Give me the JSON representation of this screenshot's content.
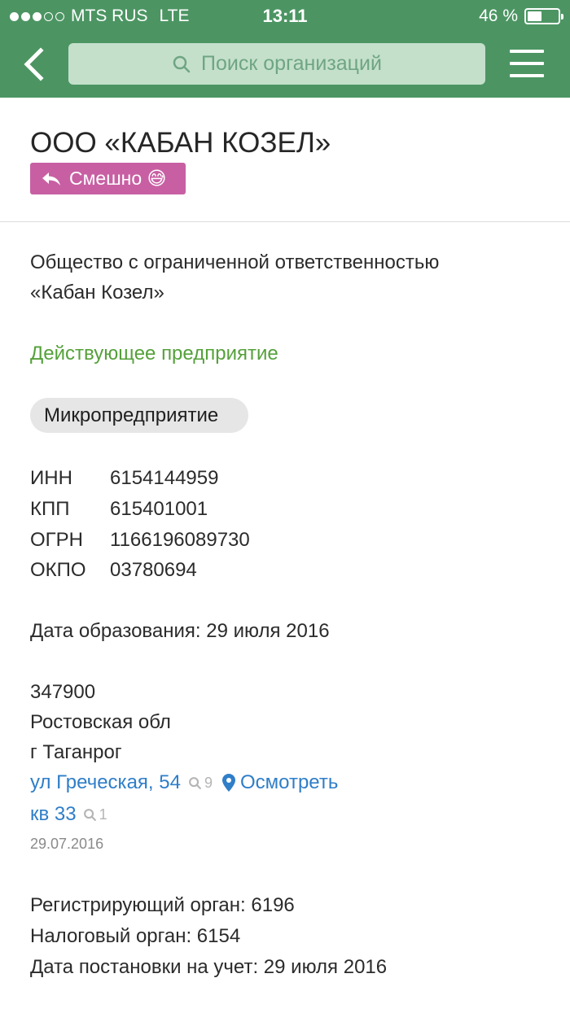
{
  "status_bar": {
    "carrier": "MTS RUS",
    "network": "LTE",
    "time": "13:11",
    "battery": "46 %",
    "signal_bars_filled": 3,
    "signal_bars_total": 5,
    "battery_level": 0.46
  },
  "nav": {
    "search_placeholder": "Поиск организаций"
  },
  "header": {
    "title": "ООО «КАБАН КОЗЕЛ»",
    "tag_label": "Смешно 😅"
  },
  "org": {
    "full_name_line1": "Общество с ограниченной ответственностью",
    "full_name_line2": "«Кабан Козел»",
    "status": "Действующее предприятие",
    "category": "Микропредприятие",
    "codes": [
      {
        "label": "ИНН",
        "value": "6154144959"
      },
      {
        "label": "КПП",
        "value": "615401001"
      },
      {
        "label": "ОГРН",
        "value": "1166196089730"
      },
      {
        "label": "ОКПО",
        "value": "03780694"
      }
    ],
    "founded": "Дата образования: 29 июля 2016",
    "address": {
      "postal_code": "347900",
      "region": "Ростовская обл",
      "city": "г Таганрог",
      "street": "ул Греческая, 54",
      "street_count": "9",
      "view_label": "Осмотреть",
      "apartment": "кв 33",
      "apartment_count": "1",
      "date": "29.07.2016"
    },
    "registering_authority": "Регистрирующий орган: 6196",
    "tax_authority": "Налоговый орган: 6154",
    "registration_date": "Дата постановки на учет: 29 июля 2016"
  },
  "colors": {
    "topbar": "#4c9563",
    "search_bg": "#c4e0cb",
    "tag": "#c85fa3",
    "status_green": "#55a13a",
    "link_blue": "#2f7ec8"
  }
}
